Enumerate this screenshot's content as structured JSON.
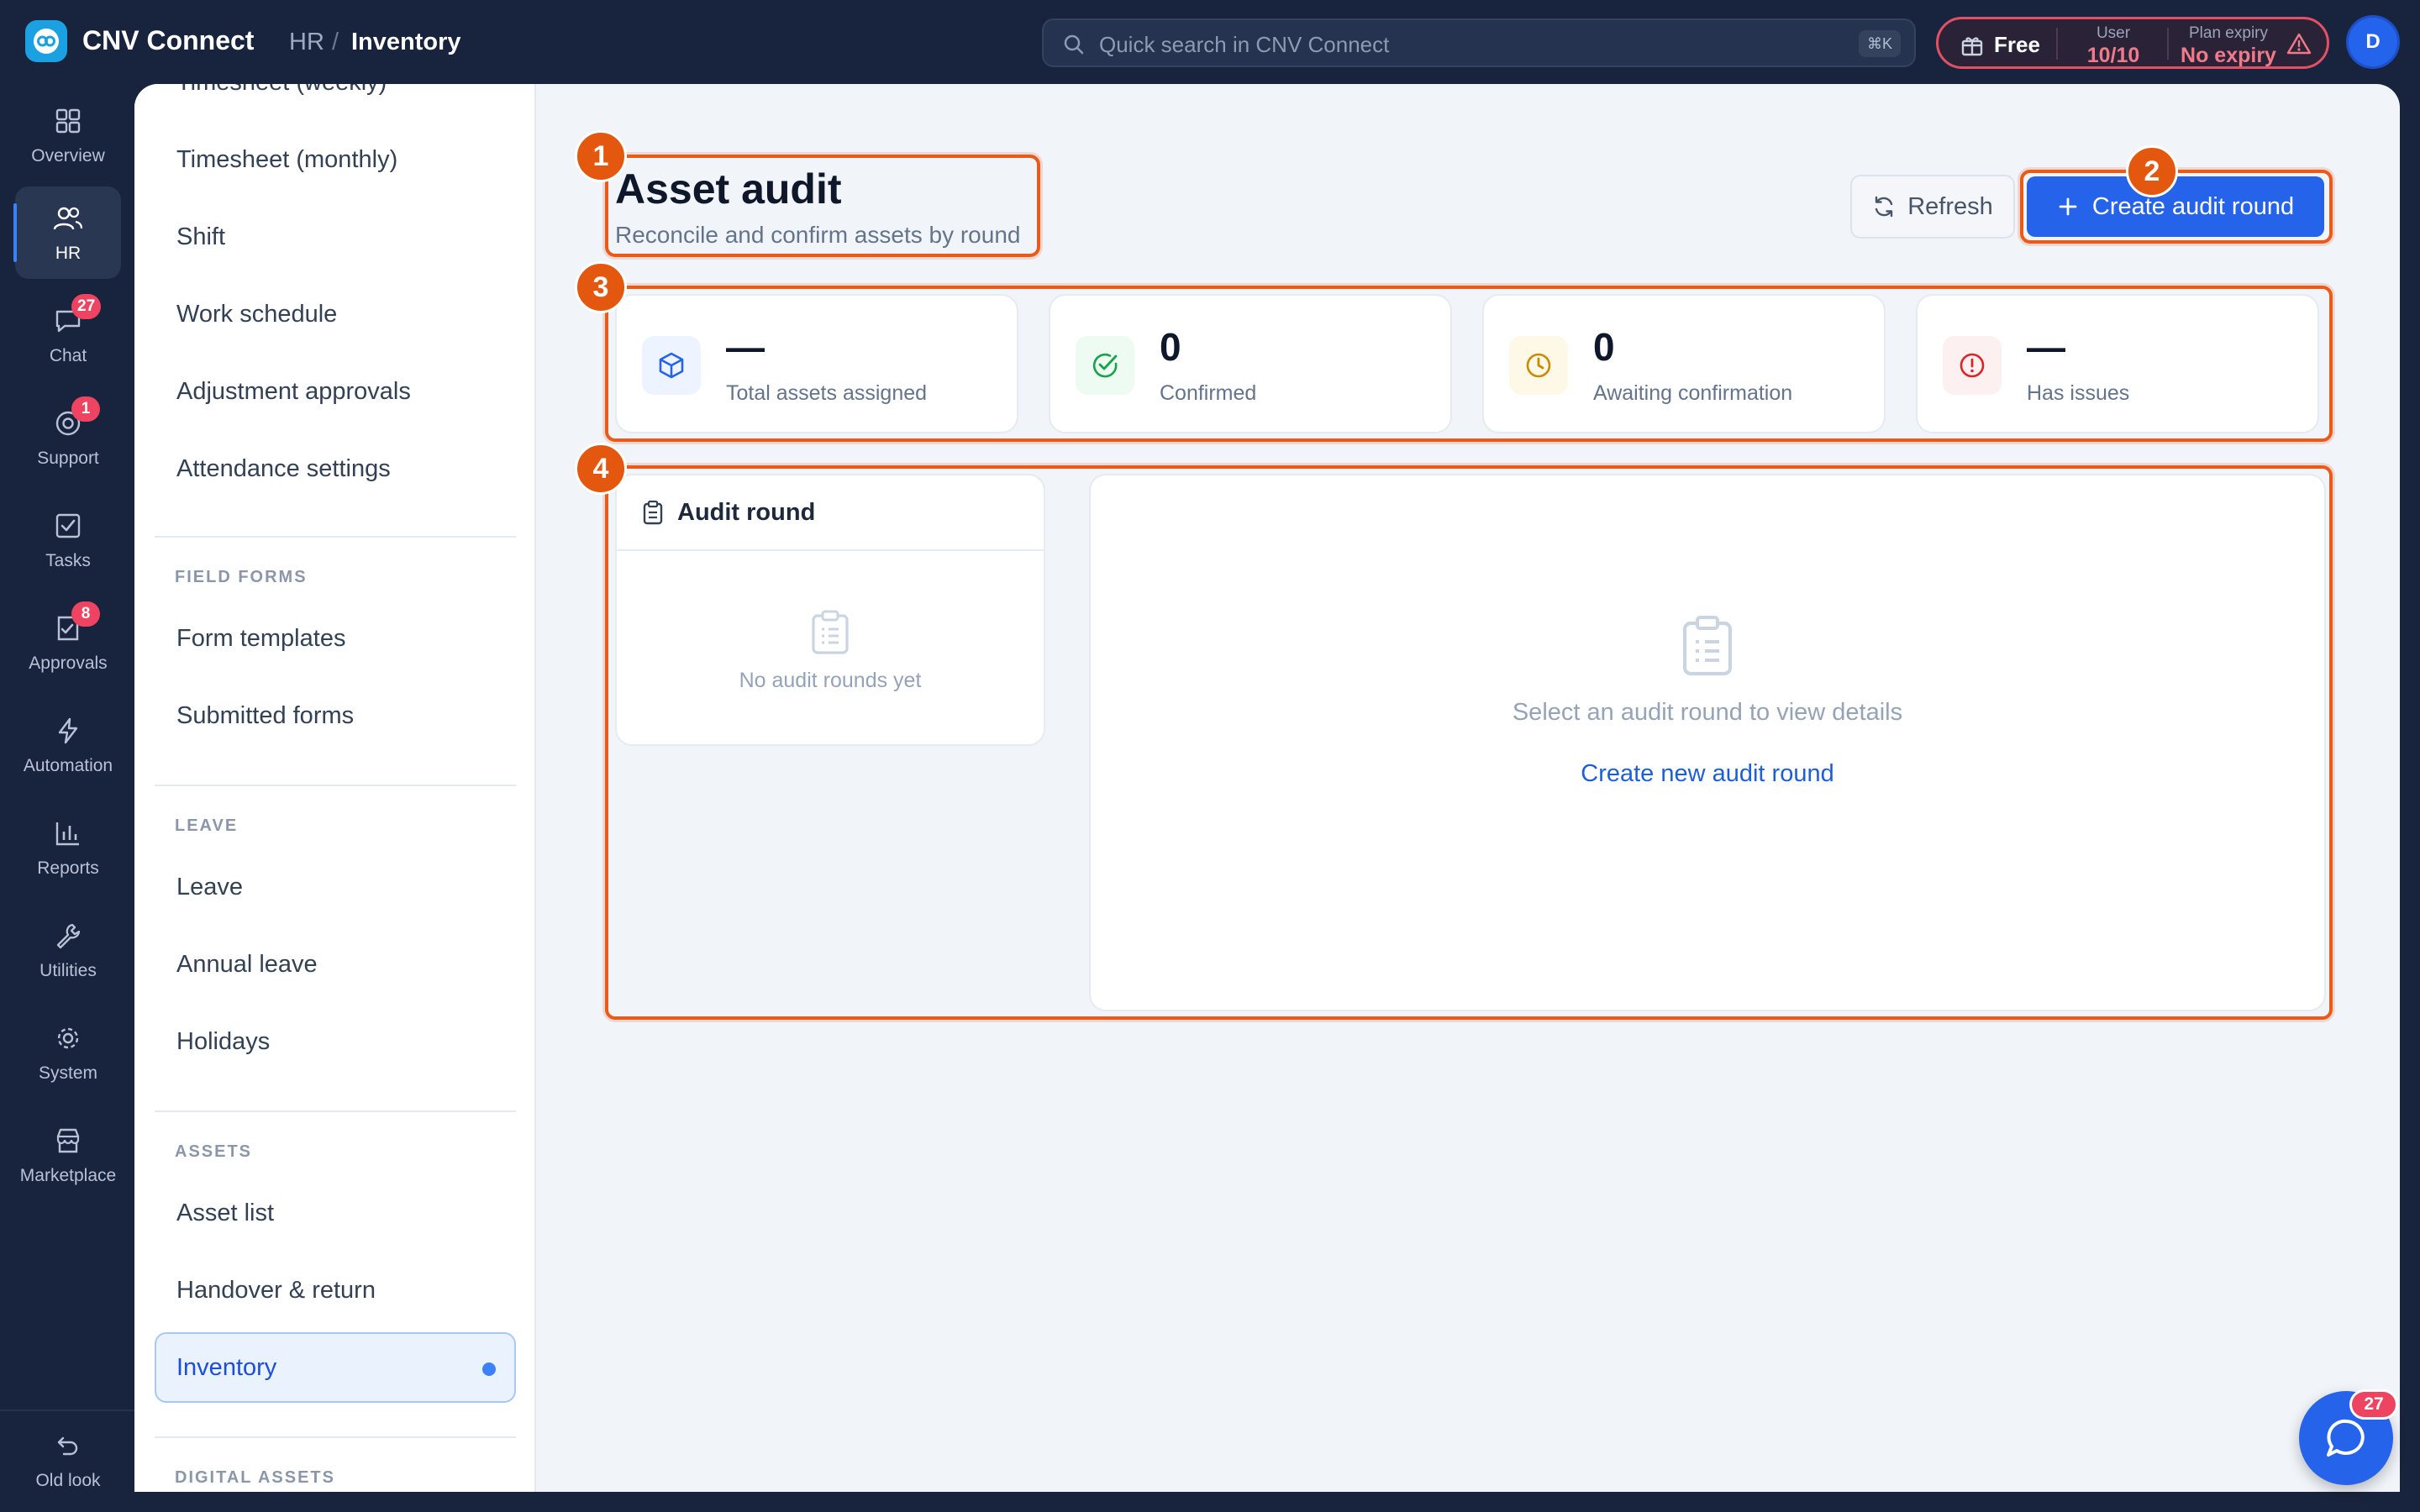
{
  "app": {
    "name": "CNV Connect",
    "breadcrumb": {
      "parent": "HR",
      "separator": "/",
      "current": "Inventory"
    }
  },
  "search": {
    "placeholder": "Quick search in CNV Connect",
    "shortcut": "⌘K"
  },
  "plan": {
    "tier": "Free",
    "user_label": "User",
    "user_value": "10/10",
    "expiry_label": "Plan expiry",
    "expiry_value": "No expiry",
    "warning_icon": "warning-icon"
  },
  "user": {
    "avatar_initial": "D"
  },
  "rail": {
    "items": [
      {
        "label": "Overview",
        "icon": "grid-icon",
        "badge": ""
      },
      {
        "label": "HR",
        "icon": "users-icon",
        "badge": "",
        "active": true
      },
      {
        "label": "Chat",
        "icon": "chat-icon",
        "badge": "27"
      },
      {
        "label": "Support",
        "icon": "support-icon",
        "badge": "1"
      },
      {
        "label": "Tasks",
        "icon": "checkbox-icon",
        "badge": ""
      },
      {
        "label": "Approvals",
        "icon": "approvals-icon",
        "badge": "8"
      },
      {
        "label": "Automation",
        "icon": "lightning-icon",
        "badge": ""
      },
      {
        "label": "Reports",
        "icon": "bar-chart-icon",
        "badge": ""
      },
      {
        "label": "Utilities",
        "icon": "wrench-icon",
        "badge": ""
      },
      {
        "label": "System",
        "icon": "gear-icon",
        "badge": ""
      },
      {
        "label": "Marketplace",
        "icon": "store-icon",
        "badge": ""
      }
    ],
    "old_look": "Old look"
  },
  "subnav": {
    "items": [
      {
        "label": "Timesheet (weekly)"
      },
      {
        "label": "Timesheet (monthly)"
      },
      {
        "label": "Shift"
      },
      {
        "label": "Work schedule"
      },
      {
        "label": "Adjustment approvals"
      },
      {
        "label": "Attendance settings"
      }
    ],
    "field_forms": {
      "title": "FIELD FORMS",
      "items": [
        "Form templates",
        "Submitted forms"
      ]
    },
    "leave": {
      "title": "LEAVE",
      "items": [
        "Leave",
        "Annual leave",
        "Holidays"
      ]
    },
    "assets": {
      "title": "ASSETS",
      "items": [
        "Asset list",
        "Handover & return",
        "Inventory"
      ]
    },
    "digital_assets": {
      "title": "DIGITAL ASSETS"
    }
  },
  "page": {
    "title": "Asset audit",
    "subtitle": "Reconcile and confirm assets by round",
    "refresh_label": "Refresh",
    "create_label": "Create audit round"
  },
  "stats": [
    {
      "value": "—",
      "label": "Total assets assigned",
      "icon": "box-icon",
      "color": "#2563eb",
      "bg": "#eef4ff"
    },
    {
      "value": "0",
      "label": "Confirmed",
      "icon": "check-circle-icon",
      "color": "#16a34a",
      "bg": "#eefbf2"
    },
    {
      "value": "0",
      "label": "Awaiting confirmation",
      "icon": "clock-icon",
      "color": "#ca8a04",
      "bg": "#fef9e7"
    },
    {
      "value": "—",
      "label": "Has issues",
      "icon": "alert-circle-icon",
      "color": "#dc2626",
      "bg": "#fdf0f0"
    }
  ],
  "audit_round": {
    "title": "Audit round",
    "empty_text": "No audit rounds yet"
  },
  "detail": {
    "empty_text": "Select an audit round to view details",
    "create_link": "Create new audit round"
  },
  "annotations": [
    "1",
    "2",
    "3",
    "4"
  ],
  "chat_fab": {
    "badge": "27"
  },
  "colors": {
    "accent": "#2563eb",
    "annotation": "#ea5b1a",
    "nav_bg": "#18243d"
  }
}
